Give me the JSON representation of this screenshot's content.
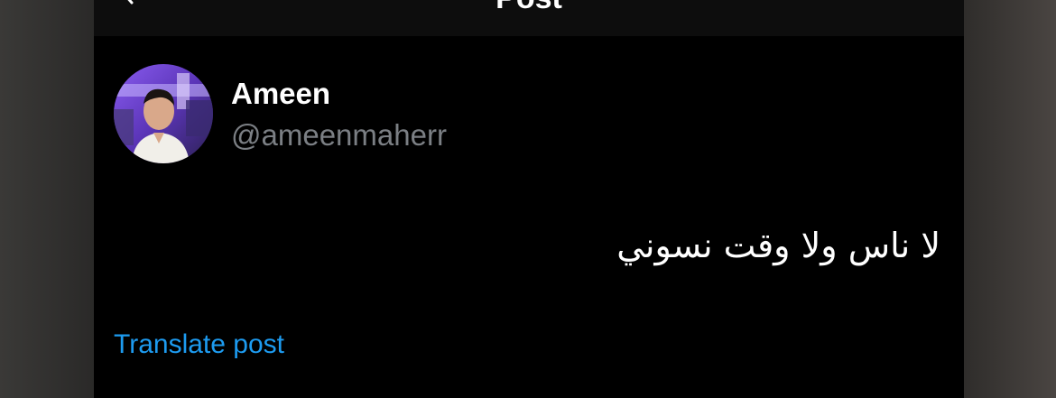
{
  "topbar": {
    "title": "Post",
    "back_icon": "arrow-left-icon"
  },
  "post": {
    "author": {
      "display_name": "Ameen",
      "handle": "@ameenmaherr",
      "avatar_icon": "profile-photo"
    },
    "text": "لا ناس ولا وقت نسوني",
    "translate_label": "Translate post"
  },
  "colors": {
    "background": "#000000",
    "name": "#ffffff",
    "handle": "#7b7f84",
    "link": "#1d9bf0",
    "avatar_bg": "#6a3fc8"
  }
}
